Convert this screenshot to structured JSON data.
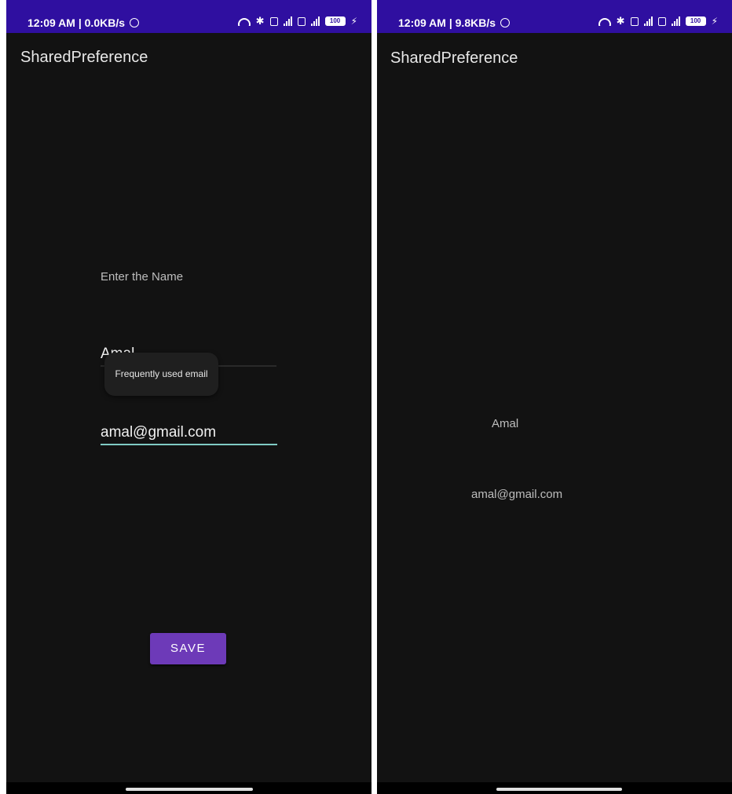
{
  "left": {
    "status": {
      "time": "12:09 AM | 0.0KB/s",
      "battery": "100"
    },
    "app_title": "SharedPreference",
    "name_label": "Enter the Name",
    "name_value": "Amal",
    "tooltip": "Frequently used email",
    "email_value": "amal@gmail.com",
    "save_label": "SAVE"
  },
  "right": {
    "status": {
      "time": "12:09 AM | 9.8KB/s",
      "battery": "100"
    },
    "app_title": "SharedPreference",
    "saved_name": "Amal",
    "saved_email": "amal@gmail.com"
  },
  "colors": {
    "status_bar": "#2f0fa0",
    "background": "#121212",
    "accent_button": "#6d3ab8",
    "focus_underline": "#80cbc4"
  },
  "icons": [
    "alarm-icon",
    "wifi-icon",
    "bluetooth-icon",
    "signal-icon",
    "sim-icon",
    "battery-icon",
    "charging-icon"
  ]
}
